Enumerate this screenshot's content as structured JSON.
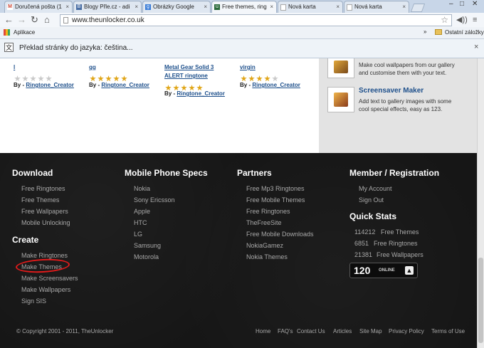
{
  "tabs": [
    {
      "title": "Doručená pošta (1",
      "icon": "gmail-icon",
      "color": "#d14836"
    },
    {
      "title": "Blogy Přle.cz - adi",
      "icon": "blog-icon",
      "color": "#4a6fa5"
    },
    {
      "title": "Obrázky Google",
      "icon": "google-icon",
      "color": "#3b7dd8"
    },
    {
      "title": "Free themes, ring",
      "icon": "unlocker-icon",
      "color": "#2a6a3a"
    },
    {
      "title": "Nová karta",
      "icon": "page-icon",
      "color": "#ffffff"
    },
    {
      "title": "Nová karta",
      "icon": "page-icon",
      "color": "#ffffff"
    }
  ],
  "toolbar": {
    "url": "www.theunlocker.co.uk"
  },
  "bookmarks": {
    "apps_label": "Aplikace",
    "more": "»",
    "other_label": "Ostatní záložky"
  },
  "translate": {
    "text": "Překlad stránky do jazyka: čeština..."
  },
  "ringtones": [
    {
      "title": "l",
      "by_label": "By -",
      "author": "Ringtone_Creator",
      "rating": 0
    },
    {
      "title": "gg",
      "by_label": "By -",
      "author": "Ringtone_Creator",
      "rating": 5
    },
    {
      "title_line1": "Metal Gear Solid 3",
      "title_line2": "ALERT ringtone",
      "by_label": "By -",
      "author": "Ringtone_Creator",
      "rating": 5
    },
    {
      "title": "virgin",
      "by_label": "By -",
      "author": "Ringtone_Creator",
      "rating": 4
    }
  ],
  "sidebar_features": {
    "wallpaper_desc_1": "Make cool wallpapers from our gallery",
    "wallpaper_desc_2": "and customise them with your text.",
    "screensaver_title": "Screensaver Maker",
    "screensaver_desc_1": "Add text to gallery images with some",
    "screensaver_desc_2": "cool special effects, easy as 123."
  },
  "footer": {
    "download": {
      "title": "Download",
      "links": [
        "Free Ringtones",
        "Free Themes",
        "Free Wallpapers",
        "Mobile Unlocking"
      ]
    },
    "create": {
      "title": "Create",
      "links": [
        "Make Ringtones",
        "Make Themes",
        "Make Screensavers",
        "Make Wallpapers",
        "Sign SIS"
      ]
    },
    "specs": {
      "title": "Mobile Phone Specs",
      "links": [
        "Nokia",
        "Sony Ericsson",
        "Apple",
        "HTC",
        "LG",
        "Samsung",
        "Motorola"
      ]
    },
    "partners": {
      "title": "Partners",
      "links": [
        "Free Mp3 Ringtones",
        "Free Mobile Themes",
        "Free Ringtones",
        "TheFreeSite",
        "Free Mobile Downloads",
        "NokiaGamez",
        "Nokia Themes"
      ]
    },
    "member": {
      "title": "Member / Registration",
      "links": [
        "My Account",
        "Sign Out"
      ]
    },
    "stats": {
      "title": "Quick Stats",
      "rows": [
        {
          "count": "114212",
          "label": "Free Themes"
        },
        {
          "count": "6851",
          "label": "Free Ringtones"
        },
        {
          "count": "21381",
          "label": "Free Wallpapers"
        }
      ],
      "online_count": "120",
      "online_label": "ONLINE"
    },
    "copyright": "© Copyright 2001 - 2011, TheUnlocker",
    "bottom_links": [
      "Home",
      "FAQ's",
      "Contact Us",
      "Articles",
      "Site Map",
      "Privacy Policy",
      "Terms of Use"
    ]
  },
  "colors": {
    "star_gold": "#e0a516",
    "star_empty": "#c9c9c9",
    "highlight": "#e01b1b",
    "link_blue": "#1d4f8b"
  }
}
